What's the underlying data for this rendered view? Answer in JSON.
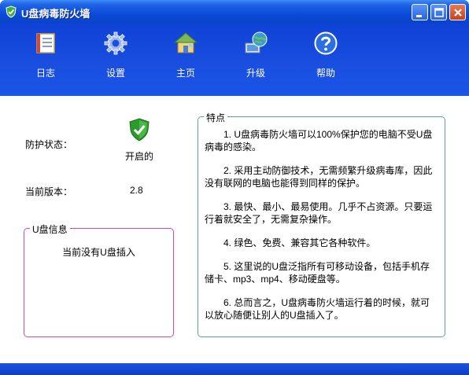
{
  "window": {
    "title": "U盘病毒防火墙"
  },
  "toolbar": {
    "items": [
      {
        "label": "日志",
        "icon": "log-icon"
      },
      {
        "label": "设置",
        "icon": "gear-icon"
      },
      {
        "label": "主页",
        "icon": "home-icon"
      },
      {
        "label": "升级",
        "icon": "upgrade-icon"
      },
      {
        "label": "帮助",
        "icon": "help-icon"
      }
    ]
  },
  "status": {
    "protection_label": "防护状态：",
    "protection_value": "开启的",
    "version_label": "当前版本：",
    "version_value": "2.8"
  },
  "usb_info": {
    "title": "U盘信息",
    "message": "当前没有U盘插入"
  },
  "features": {
    "title": "特点",
    "items": [
      "1. U盘病毒防火墙可以100%保护您的电脑不受U盘病毒的感染。",
      "2. 采用主动防御技术，无需频繁升级病毒库，因此没有联网的电脑也能得到同样的保护。",
      "3. 最快、最小、最易使用。几乎不占资源。只要运行着就安全了，无需复杂操作。",
      "4. 绿色、免费、兼容其它各种软件。",
      "5. 这里说的U盘泛指所有可移动设备，包括手机存储卡、mp3、mp4、移动硬盘等。",
      "6. 总而言之，U盘病毒防火墙运行着的时候，就可以放心随便让别人的U盘插入了。"
    ]
  },
  "colors": {
    "title_bar": "#0a4bd8",
    "toolbar": "#1a4fe0",
    "shield": "#2e9a2e",
    "usb_group_border": "#d9479e",
    "features_group_border": "#5fa0a8"
  }
}
